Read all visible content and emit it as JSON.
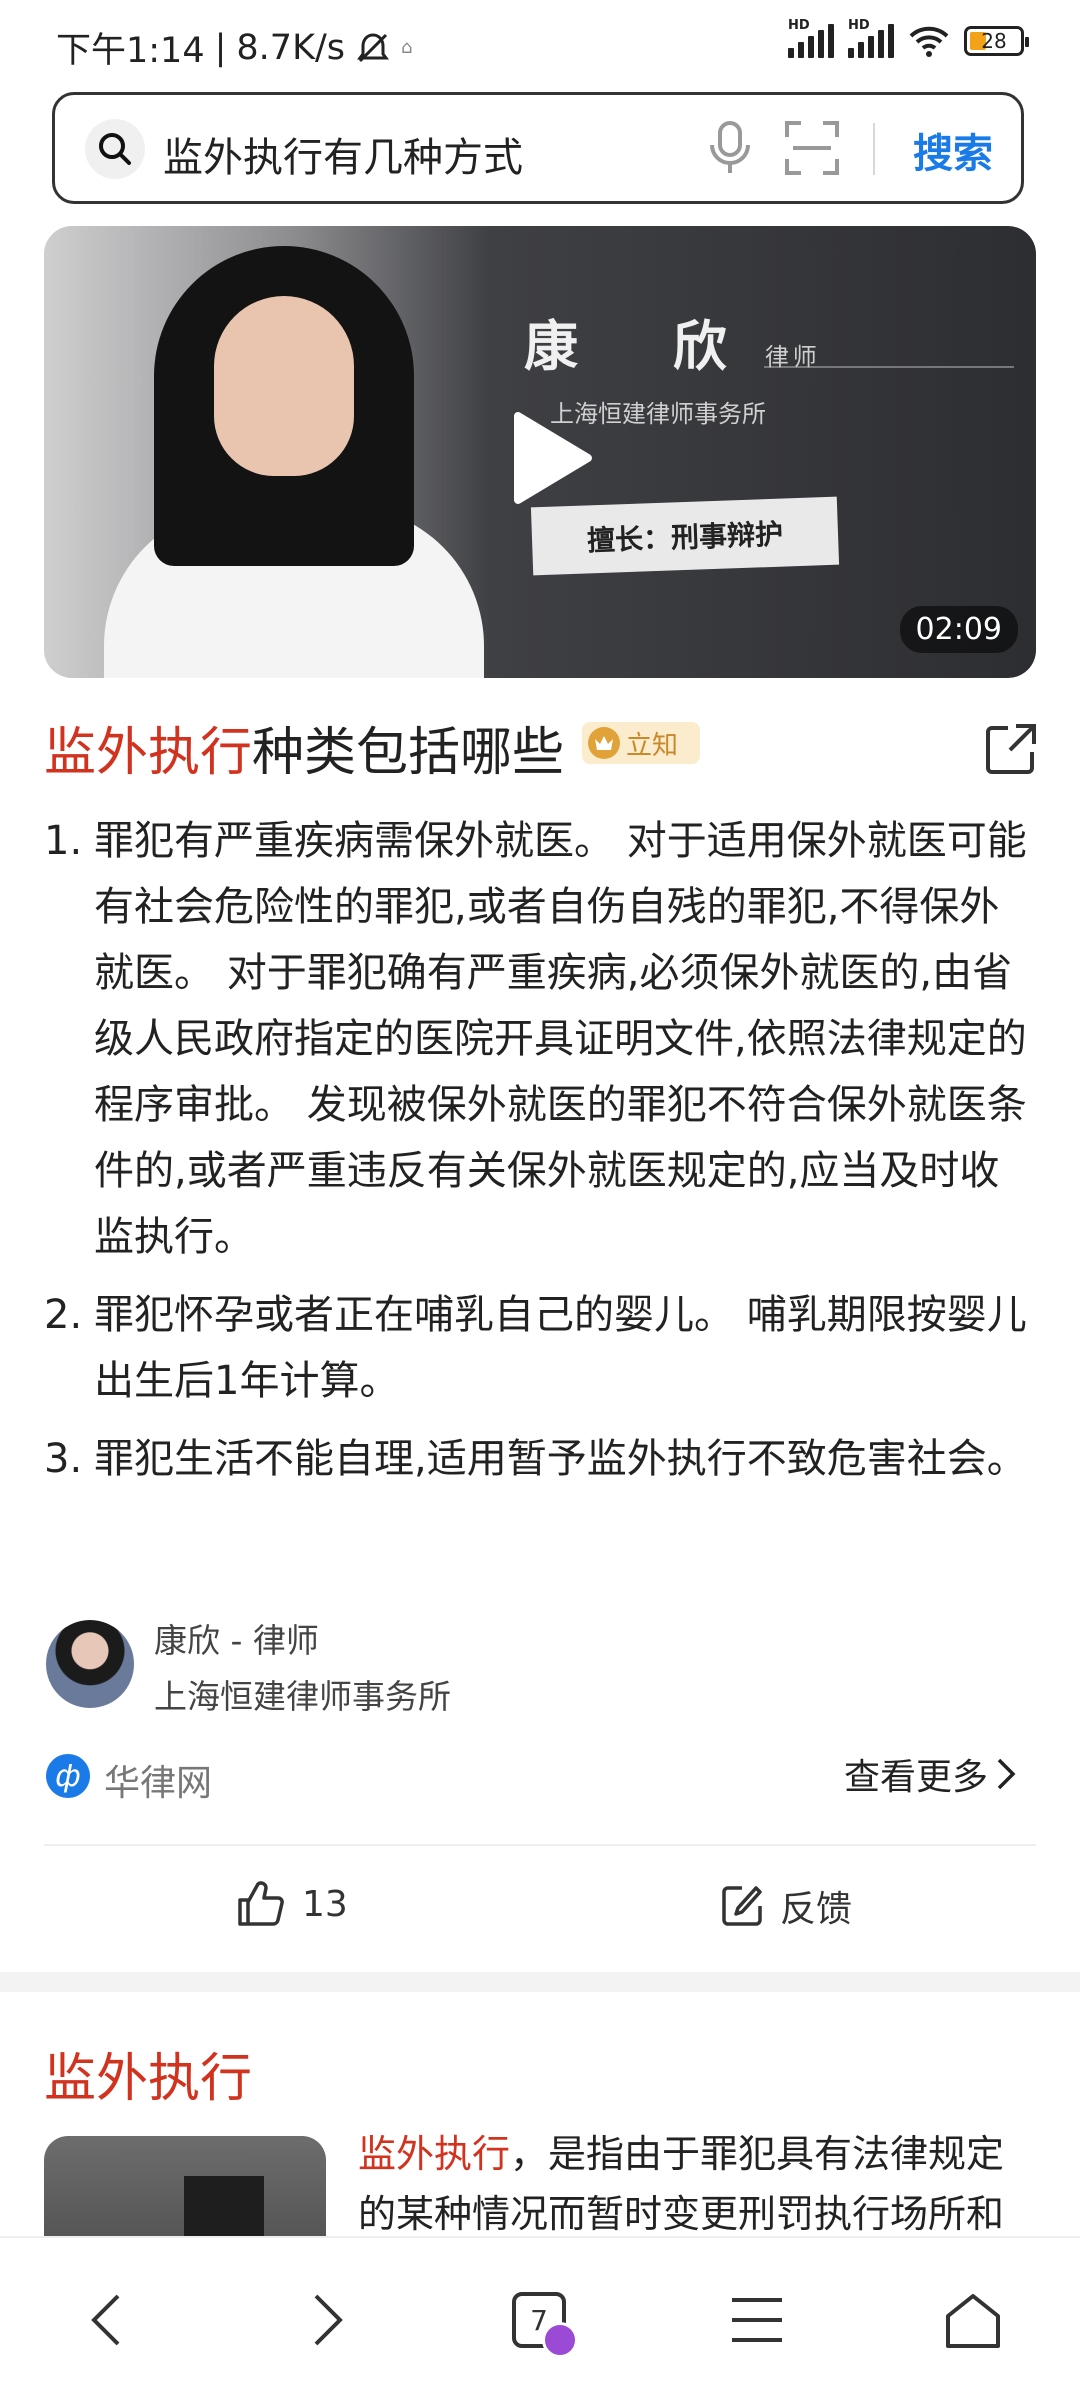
{
  "status_bar": {
    "time": "下午1:14",
    "speed": "8.7K/s",
    "battery": "28",
    "hd1": "HD",
    "hd2": "HD"
  },
  "search": {
    "query": "监外执行有几种方式",
    "button": "搜索"
  },
  "video": {
    "lawyer_name": "康 欣",
    "lawyer_title": "律师",
    "firm": "上海恒建律师事务所",
    "specialty": "擅长：刑事辩护",
    "duration": "02:09"
  },
  "answer": {
    "title_highlight": "监外执行",
    "title_rest": "种类包括哪些",
    "badge": "立知",
    "items": [
      {
        "num": "1.",
        "text": "罪犯有严重疾病需保外就医。 对于适用保外就医可能有社会危险性的罪犯,或者自伤自残的罪犯,不得保外就医。 对于罪犯确有严重疾病,必须保外就医的,由省级人民政府指定的医院开具证明文件,依照法律规定的程序审批。 发现被保外就医的罪犯不符合保外就医条件的,或者严重违反有关保外就医规定的,应当及时收监执行。"
      },
      {
        "num": "2.",
        "text": "罪犯怀孕或者正在哺乳自己的婴儿。 哺乳期限按婴儿出生后1年计算。"
      },
      {
        "num": "3.",
        "text": "罪犯生活不能自理,适用暂予监外执行不致危害社会。"
      }
    ],
    "author_name": "康欣 - 律师",
    "author_firm": "上海恒建律师事务所",
    "source": "华律网",
    "more": "查看更多",
    "likes": "13",
    "feedback": "反馈"
  },
  "section": {
    "title": "监外执行",
    "desc_highlight": "监外执行",
    "desc_rest": "，是指由于罪犯具有法律规定的某种情况而暂时变更刑罚执行场所和"
  },
  "nav": {
    "tabs": "7"
  },
  "colors": {
    "accent_red": "#d1331f",
    "link_blue": "#1a7be8"
  }
}
